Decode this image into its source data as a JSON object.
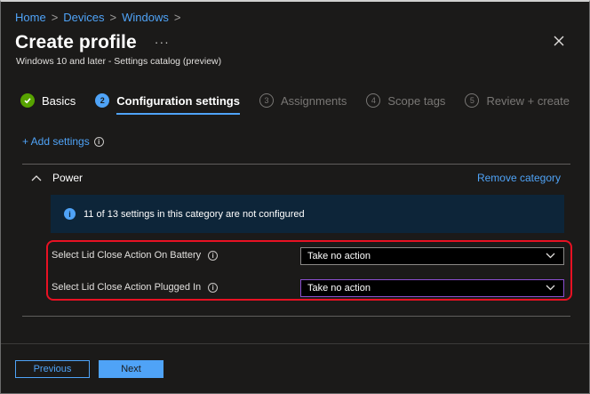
{
  "breadcrumb": [
    "Home",
    "Devices",
    "Windows"
  ],
  "header": {
    "title": "Create profile",
    "more": "···",
    "subtitle": "Windows 10 and later - Settings catalog (preview)"
  },
  "steps": [
    {
      "num": "✓",
      "label": "Basics",
      "state": "done"
    },
    {
      "num": "2",
      "label": "Configuration settings",
      "state": "active"
    },
    {
      "num": "3",
      "label": "Assignments",
      "state": "pending"
    },
    {
      "num": "4",
      "label": "Scope tags",
      "state": "pending"
    },
    {
      "num": "5",
      "label": "Review + create",
      "state": "pending"
    }
  ],
  "add_settings_label": "+ Add settings",
  "category": {
    "name": "Power",
    "remove_label": "Remove category",
    "info_text": "11 of 13 settings in this category are not configured",
    "settings": [
      {
        "label": "Select Lid Close Action On Battery",
        "value": "Take no action"
      },
      {
        "label": "Select Lid Close Action Plugged In",
        "value": "Take no action"
      }
    ]
  },
  "footer": {
    "previous_label": "Previous",
    "next_label": "Next"
  },
  "colors": {
    "accent": "#4fa3f7",
    "success": "#57a300",
    "highlight": "#e81123",
    "info_banner": "#0d2539"
  },
  "icons": [
    "chevron-right-icon",
    "more-icon",
    "close-icon",
    "check-icon",
    "info-icon",
    "chevron-up-icon",
    "chevron-down-icon"
  ]
}
